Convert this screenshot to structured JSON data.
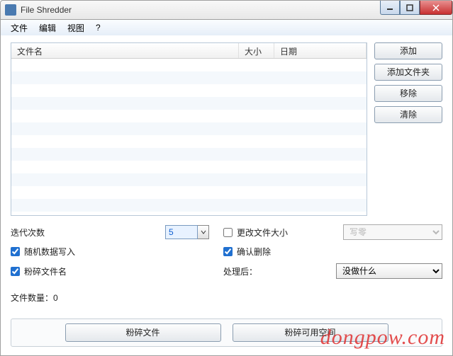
{
  "window": {
    "title": "File Shredder"
  },
  "menu": {
    "file": "文件",
    "edit": "编辑",
    "view": "视图",
    "help": "?"
  },
  "columns": {
    "name": "文件名",
    "size": "大小",
    "date": "日期"
  },
  "buttons": {
    "add": "添加",
    "addFolder": "添加文件夹",
    "remove": "移除",
    "clear": "清除",
    "shred": "粉碎文件",
    "shredFree": "粉碎可用空间"
  },
  "labels": {
    "iterations": "迭代次数",
    "randomWrite": "随机数据写入",
    "shredName": "粉碎文件名",
    "changeSize": "更改文件大小",
    "confirmDelete": "确认删除",
    "after": "处理后：",
    "fileCount": "文件数量：0"
  },
  "values": {
    "iterations": "5",
    "writeMode": "写零",
    "afterAction": "没做什么"
  },
  "watermark": "dongpow.com"
}
